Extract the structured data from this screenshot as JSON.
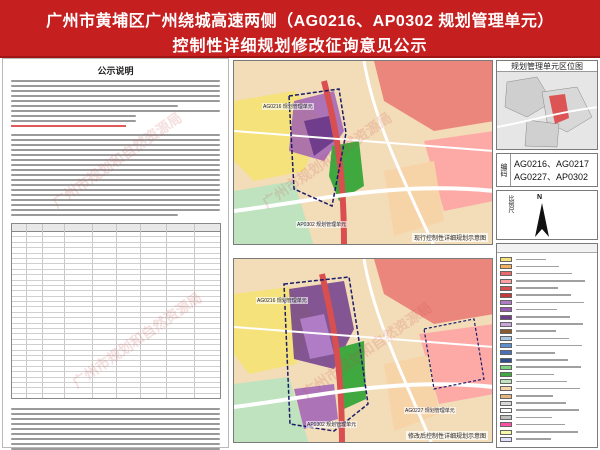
{
  "header": {
    "title_line1": "广州市黄埔区广州绕城高速两侧（AG0216、AP0302 规划管理单元）",
    "title_line2": "控制性详细规划修改征询意见公示"
  },
  "left_panel": {
    "section_title": "公示说明",
    "table_title": "征询意见统计表"
  },
  "maps": {
    "top": {
      "caption": "现行控制性详细规划示意图",
      "labels": [
        "AG0216 规划管理单元",
        "AP0302 规划管理单元"
      ]
    },
    "bottom": {
      "caption": "修改后控制性详细规划示意图",
      "labels": [
        "AG0216 规划管理单元",
        "AP0302 规划管理单元",
        "AG0227 规划管理单元"
      ]
    }
  },
  "right_panel": {
    "location_title": "规划管理单元区位图",
    "code_key": "编码",
    "codes_line1": "AG0216、AG0217",
    "codes_line2": "AG0227、AP0302",
    "north_label": "N",
    "side_label": "比例尺"
  },
  "legend": {
    "colors": [
      "#f5e27a",
      "#f2b05c",
      "#e86a6a",
      "#ff9ea3",
      "#d94f4f",
      "#c43a3a",
      "#b07cc6",
      "#9b59b6",
      "#6f3d8c",
      "#c9a6d9",
      "#8b5a2b",
      "#a8c8e8",
      "#5b8fd0",
      "#4a6fb5",
      "#2f4f8f",
      "#7ed37e",
      "#3fa83f",
      "#bfe3bf",
      "#f7d4a8",
      "#e6b47f",
      "#d8d8d8",
      "#ffffff",
      "#c0c0c0",
      "#ff4fa3",
      "#f7f7a8",
      "#e0e0ff"
    ]
  },
  "watermark": "广州市规划和自然资源局"
}
